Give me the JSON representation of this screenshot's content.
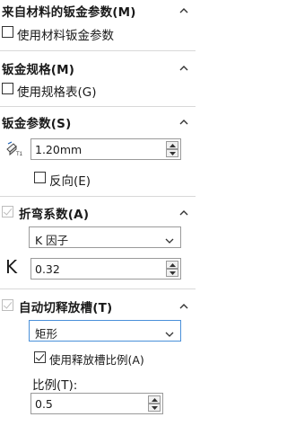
{
  "sections": {
    "custom_material": {
      "title": "来自材料的钣金参数(M)",
      "checkbox_label": "使用材料钣金参数",
      "checked": false
    },
    "gauge": {
      "title": "钣金规格(M)",
      "checkbox_label": "使用规格表(G)",
      "checked": false
    },
    "parameters": {
      "title": "钣金参数(S)",
      "thickness_value": "1.20mm",
      "reverse_label": "反向(E)",
      "reverse_checked": false
    },
    "bend_allowance": {
      "title": "折弯系数(A)",
      "checked": true,
      "type_value": "K 因子",
      "k_symbol": "K",
      "k_value": "0.32"
    },
    "relief": {
      "title": "自动切释放槽(T)",
      "checked": true,
      "type_value": "矩形",
      "ratio_checkbox_label": "使用释放槽比例(A)",
      "ratio_checked": true,
      "ratio_label": "比例(T):",
      "ratio_value": "0.5"
    }
  },
  "icons": [
    "chevron-up-icon",
    "thickness-icon",
    "spin-up-icon",
    "spin-down-icon",
    "dropdown-arrow-icon"
  ]
}
